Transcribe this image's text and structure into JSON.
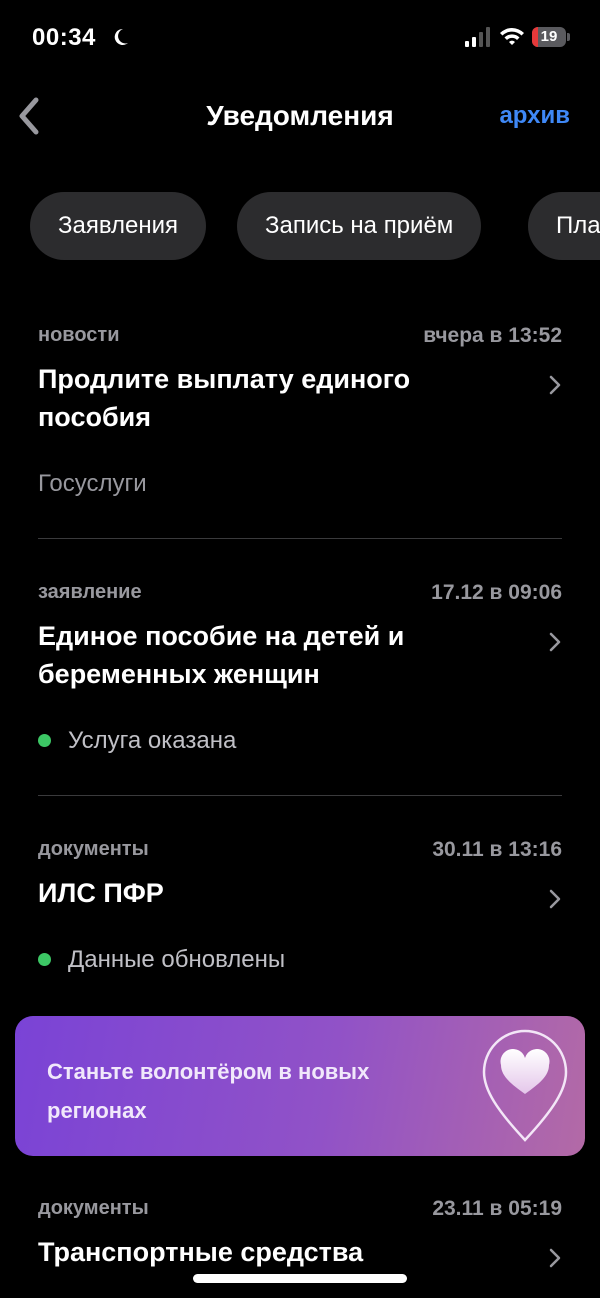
{
  "status_bar": {
    "time": "00:34",
    "battery_level": "19",
    "battery_color": "#e5393a"
  },
  "nav": {
    "title": "Уведомления",
    "archive_label": "архив",
    "accent_color": "#3f88f6"
  },
  "chips": [
    {
      "label": "Заявления"
    },
    {
      "label": "Запись на приём"
    },
    {
      "label": "Платежи"
    }
  ],
  "notifications": [
    {
      "category": "новости",
      "time": "вчера в 13:52",
      "title": "Продлите выплату единого пособия",
      "source": "Госуслуги"
    },
    {
      "category": "заявление",
      "time": "17.12 в 09:06",
      "title": "Единое пособие на детей и беременных женщин",
      "status": "Услуга оказана",
      "status_color": "#3cc765"
    },
    {
      "category": "документы",
      "time": "30.11 в 13:16",
      "title": "ИЛС ПФР",
      "status": "Данные обновлены",
      "status_color": "#3cc765"
    },
    {
      "category": "документы",
      "time": "23.11 в 05:19",
      "title": "Транспортные средства"
    }
  ],
  "banner": {
    "text": "Станьте волонтёром в новых регионах",
    "icon": "heart-pin-icon"
  }
}
